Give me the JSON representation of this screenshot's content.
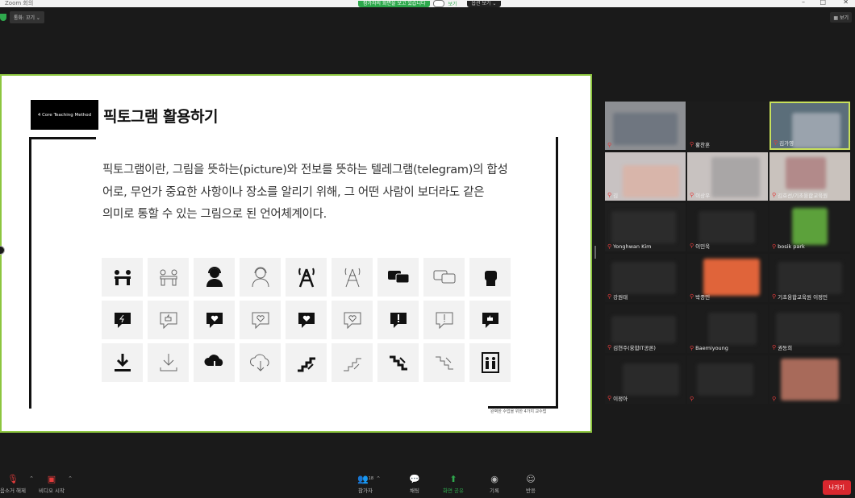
{
  "titlebar": {
    "app_title": "Zoom 회의",
    "minimize": "–",
    "maximize": "□",
    "close": "✕"
  },
  "share_banner": {
    "status": "참가자의 화면을 보고 있습니다",
    "toggle_off_label": "보기",
    "options_label": "옵션 보기 ⌄"
  },
  "top_left": {
    "speaker_label": "통화: 꼬기 ⌄"
  },
  "view_button": {
    "label": "보기"
  },
  "slide": {
    "tag": "4 Core Teaching Method",
    "title": "픽토그램 활용하기",
    "body": [
      "픽토그램이란, 그림을 뜻하는(picture)와 전보를 뜻하는 텔레그램(telegram)의 합성",
      "어로, 무언가 중요한 사항이나 장소를 알리기 위해, 그 어떤 사람이 보더라도 같은",
      "의미로 통할 수 있는 그림으로 된 언어체계이다."
    ],
    "footer": "완벽한 수업을 위한 4가지 교수법",
    "icons": [
      "meeting-icon",
      "meeting-outline-icon",
      "headset-user-icon",
      "headset-user-outline-icon",
      "tower-icon",
      "tower-outline-icon",
      "chat-bubbles-icon",
      "chat-bubbles-outline-icon",
      "fist-icon",
      "flash-message-icon",
      "thumbsup-message-outline-icon",
      "heart-message-icon",
      "heart-message-outline-icon",
      "heart-message-icon",
      "heart-message-outline-icon",
      "alert-message-icon",
      "alert-message-outline-icon",
      "thumbsup-message-icon",
      "download-icon",
      "download-outline-icon",
      "cloud-download-icon",
      "cloud-download-outline-icon",
      "stairs-up-icon",
      "stairs-up-outline-icon",
      "stairs-down-icon",
      "stairs-down-outline-icon",
      "elevator-icon"
    ]
  },
  "participants": [
    {
      "name": ""
    },
    {
      "name": "황찬혼"
    },
    {
      "name": "김가영"
    },
    {
      "name": "김"
    },
    {
      "name": "이상우"
    },
    {
      "name": "김효선/기초융합교육원"
    },
    {
      "name": "Yonghwan Kim"
    },
    {
      "name": "이민욱"
    },
    {
      "name": "bosik park"
    },
    {
      "name": "강원태"
    },
    {
      "name": "박종민"
    },
    {
      "name": "기초융합교육원 이정민"
    },
    {
      "name": "김현주(융합IT공론)"
    },
    {
      "name": "Baemiyoung"
    },
    {
      "name": "권동희"
    },
    {
      "name": "이정아"
    },
    {
      "name": ""
    },
    {
      "name": ""
    }
  ],
  "toolbar": {
    "unmute": "음소거 해제",
    "video": "비디오 시작",
    "participants": "참가자",
    "participants_count": "18",
    "chat": "채팅",
    "share": "화면 공유",
    "record": "기록",
    "reactions": "반응",
    "leave": "나가기"
  },
  "colors": {
    "accent_green": "#8dc63f",
    "active_speaker": "#c8e05b",
    "leave_red": "#d9272e",
    "share_green": "#2fa94d"
  }
}
